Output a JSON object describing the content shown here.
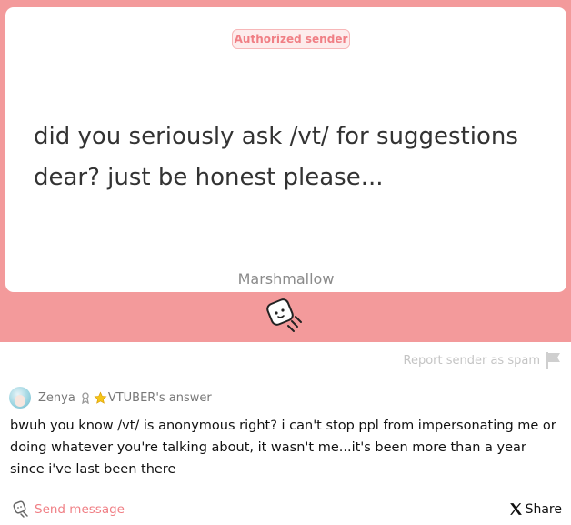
{
  "question_card": {
    "badge": "Authorized sender",
    "question": "did you seriously ask /vt/ for suggestions dear? just be honest please...",
    "brand": "Marshmallow"
  },
  "report": {
    "label": "Report sender as spam"
  },
  "answer": {
    "author_name": "Zenya",
    "author_suffix": "VTUBER's answer",
    "text": "bwuh you know /vt/ is anonymous right? i can't stop ppl from impersonating me or doing whatever you're talking about, it wasn't me...it's been more than a year since i've last been there"
  },
  "footer": {
    "send_label": "Send message",
    "share_label": "Share"
  },
  "colors": {
    "band": "#f39a9b",
    "accent": "#f07f85",
    "badge_bg": "#fdecec"
  },
  "icons": [
    "marshmallow-mascot-icon",
    "flag-icon",
    "ribbon-icon",
    "star-icon",
    "send-message-icon",
    "x-logo-icon"
  ]
}
